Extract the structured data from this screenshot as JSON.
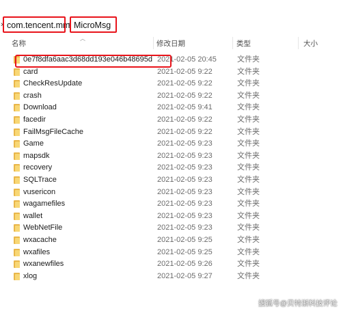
{
  "breadcrumb": {
    "items": [
      {
        "label": "com.tencent.mm"
      },
      {
        "label": "MicroMsg"
      }
    ]
  },
  "columns": {
    "name": "名称",
    "modified": "修改日期",
    "type": "类型",
    "size": "大小"
  },
  "files": [
    {
      "name": "0e7f8dfa6aac3d68dd193e046b48695d",
      "modified": "2021-02-05 20:45",
      "type": "文件夹"
    },
    {
      "name": "card",
      "modified": "2021-02-05 9:22",
      "type": "文件夹"
    },
    {
      "name": "CheckResUpdate",
      "modified": "2021-02-05 9:22",
      "type": "文件夹"
    },
    {
      "name": "crash",
      "modified": "2021-02-05 9:22",
      "type": "文件夹"
    },
    {
      "name": "Download",
      "modified": "2021-02-05 9:41",
      "type": "文件夹"
    },
    {
      "name": "facedir",
      "modified": "2021-02-05 9:22",
      "type": "文件夹"
    },
    {
      "name": "FailMsgFileCache",
      "modified": "2021-02-05 9:22",
      "type": "文件夹"
    },
    {
      "name": "Game",
      "modified": "2021-02-05 9:23",
      "type": "文件夹"
    },
    {
      "name": "mapsdk",
      "modified": "2021-02-05 9:23",
      "type": "文件夹"
    },
    {
      "name": "recovery",
      "modified": "2021-02-05 9:23",
      "type": "文件夹"
    },
    {
      "name": "SQLTrace",
      "modified": "2021-02-05 9:23",
      "type": "文件夹"
    },
    {
      "name": "vusericon",
      "modified": "2021-02-05 9:23",
      "type": "文件夹"
    },
    {
      "name": "wagamefiles",
      "modified": "2021-02-05 9:23",
      "type": "文件夹"
    },
    {
      "name": "wallet",
      "modified": "2021-02-05 9:23",
      "type": "文件夹"
    },
    {
      "name": "WebNetFile",
      "modified": "2021-02-05 9:23",
      "type": "文件夹"
    },
    {
      "name": "wxacache",
      "modified": "2021-02-05 9:25",
      "type": "文件夹"
    },
    {
      "name": "wxafiles",
      "modified": "2021-02-05 9:25",
      "type": "文件夹"
    },
    {
      "name": "wxanewfiles",
      "modified": "2021-02-05 9:26",
      "type": "文件夹"
    },
    {
      "name": "xlog",
      "modified": "2021-02-05 9:27",
      "type": "文件夹"
    }
  ],
  "watermark": "搜狐号@贝特浙科技评论",
  "colors": {
    "highlight": "#e8131a",
    "folder_back": "#e9b64a",
    "folder_front": "#f8d775"
  },
  "icons": [
    "chevron-right-icon",
    "sort-up-icon",
    "folder-icon"
  ]
}
